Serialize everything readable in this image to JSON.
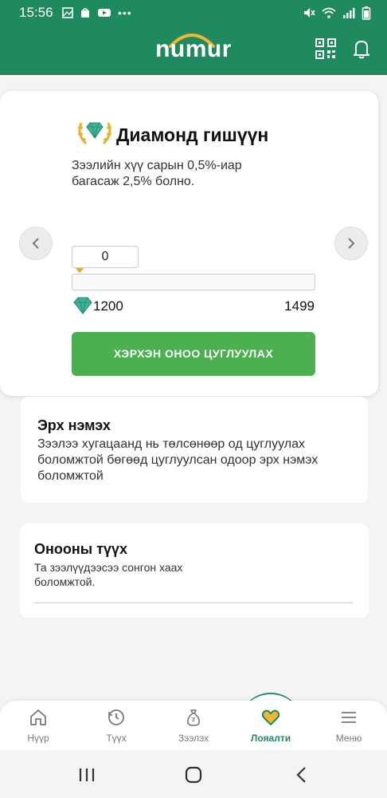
{
  "status_bar": {
    "time": "15:56"
  },
  "header": {
    "logo_text": "numur"
  },
  "tier_card": {
    "title": "Диамонд гишүүн",
    "description": "Зээлийн хүү сарын 0,5%-иар багасаж 2,5% болно.",
    "current_points": "0",
    "range_min": "1200",
    "range_max": "1499",
    "progress_fraction": 0,
    "button_label": "ХЭРХЭН ОНОО ЦУГЛУУЛАХ"
  },
  "info_cards": [
    {
      "title": "Эрх нэмэх",
      "text": "Зээлээ хугацаанд нь төлсөнөөр од цуглуулах боломжтой бөгөөд цуглуулсан одоор эрх нэмэх боломжтой"
    },
    {
      "title": "Онооны түүх",
      "text": "Та зээлүүдээсээ сонгон хаах боломжтой."
    }
  ],
  "bottom_nav": {
    "items": [
      {
        "label": "Нүүр",
        "icon": "home-icon"
      },
      {
        "label": "Түүх",
        "icon": "history-icon"
      },
      {
        "label": "Зээлэх",
        "icon": "money-bag-icon"
      },
      {
        "label": "Лояалти",
        "icon": "heart-icon"
      },
      {
        "label": "Меню",
        "icon": "menu-icon"
      }
    ],
    "active_index": 3
  },
  "colors": {
    "brand_green": "#208a5f",
    "button_green": "#4caf50",
    "accent_orange": "#e8a531"
  }
}
